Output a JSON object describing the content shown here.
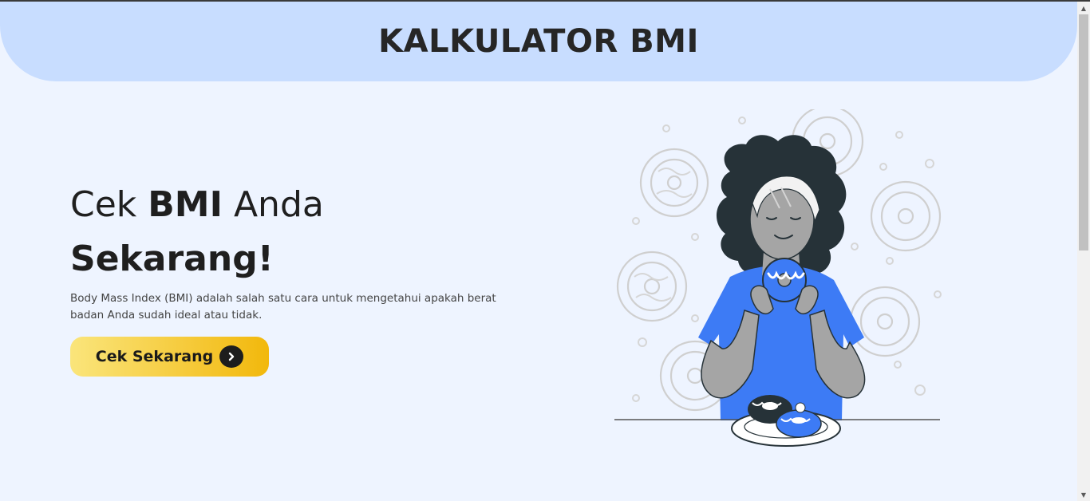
{
  "header": {
    "title": "KALKULATOR BMI"
  },
  "hero": {
    "line1_prefix": "Cek ",
    "line1_bold": "BMI",
    "line1_suffix": " Anda",
    "line2": "Sekarang!",
    "description": "Body Mass Index (BMI) adalah salah satu cara untuk mengetahui apakah berat badan Anda sudah ideal atau tidak.",
    "cta_label": "Cek Sekarang"
  },
  "icons": {
    "cta": "chevron-right-icon",
    "illustration": "woman-eating-donut-illustration"
  },
  "colors": {
    "header_bg": "#c8ddff",
    "page_bg": "#eef4ff",
    "cta_gradient_start": "#fae57b",
    "cta_gradient_end": "#f2b80c",
    "accent_blue": "#3d7bf5"
  }
}
